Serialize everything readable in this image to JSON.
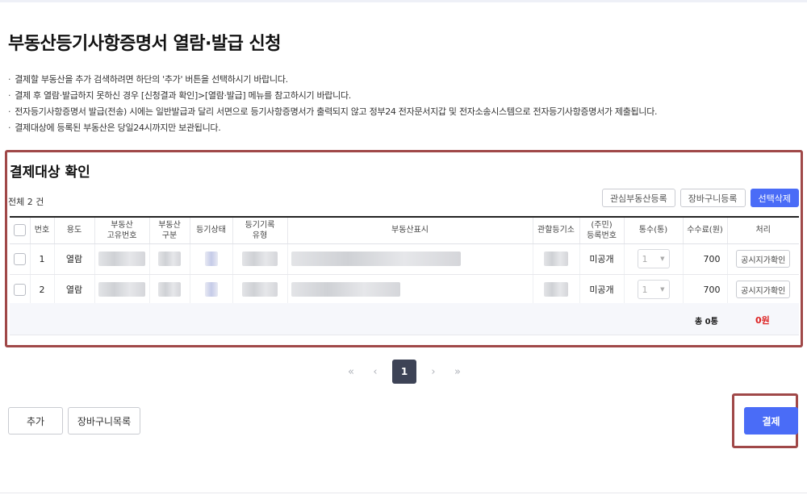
{
  "page": {
    "title": "부동산등기사항증명서 열람·발급 신청"
  },
  "notices": [
    "결제할 부동산을 추가 검색하려면 하단의 '추가' 버튼을 선택하시기 바랍니다.",
    "결제 후 열람·발급하지 못하신 경우 [신청결과 확인]>[열람·발급] 메뉴를 참고하시기 바랍니다.",
    "전자등기사항증명서 발급(전송) 시에는 일반발급과 달리 서면으로 등기사항증명서가 출력되지 않고 정부24 전자문서지갑 및 전자소송시스템으로 전자등기사항증명서가 제출됩니다.",
    "결제대상에 등록된 부동산은 당일24시까지만 보관됩니다."
  ],
  "section": {
    "title": "결제대상 확인",
    "total": "전체 2 건",
    "actions": {
      "watch": "관심부동산등록",
      "cart": "장바구니등록",
      "delete": "선택삭제"
    }
  },
  "table": {
    "headers": {
      "no": "번호",
      "usage": "용도",
      "id1": "부동산",
      "id2": "고유번호",
      "kind1": "부동산",
      "kind2": "구분",
      "status": "등기상태",
      "rec1": "등기기록",
      "rec2": "유형",
      "desc": "부동산표시",
      "office": "관할등기소",
      "reg1": "(주민)",
      "reg2": "등록번호",
      "copies": "통수(통)",
      "fee": "수수료(원)",
      "process": "처리"
    },
    "rows": [
      {
        "no": "1",
        "usage": "열람",
        "reg": "미공개",
        "copies": "1",
        "fee": "700",
        "action": "공시지가확인"
      },
      {
        "no": "2",
        "usage": "열람",
        "reg": "미공개",
        "copies": "1",
        "fee": "700",
        "action": "공시지가확인"
      }
    ],
    "summary": {
      "count_label": "총 0통",
      "amount": "0원"
    }
  },
  "pagination": {
    "first": "«",
    "prev": "‹",
    "current": "1",
    "next": "›",
    "last": "»"
  },
  "footer": {
    "add": "추가",
    "cart_list": "장바구니목록",
    "pay": "결제"
  },
  "colors": {
    "primary": "#4a6cf7",
    "highlight": "#a04848",
    "amount": "#dd2222",
    "pager_active": "#3d4356"
  }
}
